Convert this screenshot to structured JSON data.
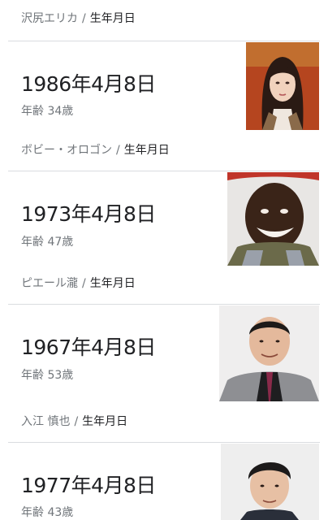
{
  "results": [
    {
      "name": "沢尻エリカ",
      "attribute": "生年月日"
    },
    {
      "date": "1986年4月8日",
      "age": "年齢 34歳",
      "photo_icon": "person-photo",
      "next_name": "ボビー・オロゴン",
      "next_attribute": "生年月日"
    },
    {
      "date": "1973年4月8日",
      "age": "年齢 47歳",
      "photo_icon": "person-photo",
      "next_name": "ピエール瀧",
      "next_attribute": "生年月日"
    },
    {
      "date": "1967年4月8日",
      "age": "年齢 53歳",
      "photo_icon": "person-photo",
      "next_name": "入江 慎也",
      "next_attribute": "生年月日"
    },
    {
      "date": "1977年4月8日",
      "age": "年齢 43歳",
      "photo_icon": "person-photo"
    }
  ],
  "separator": "/",
  "colors": {
    "text_primary": "#202124",
    "text_secondary": "#70757a",
    "divider": "#dadce0"
  }
}
